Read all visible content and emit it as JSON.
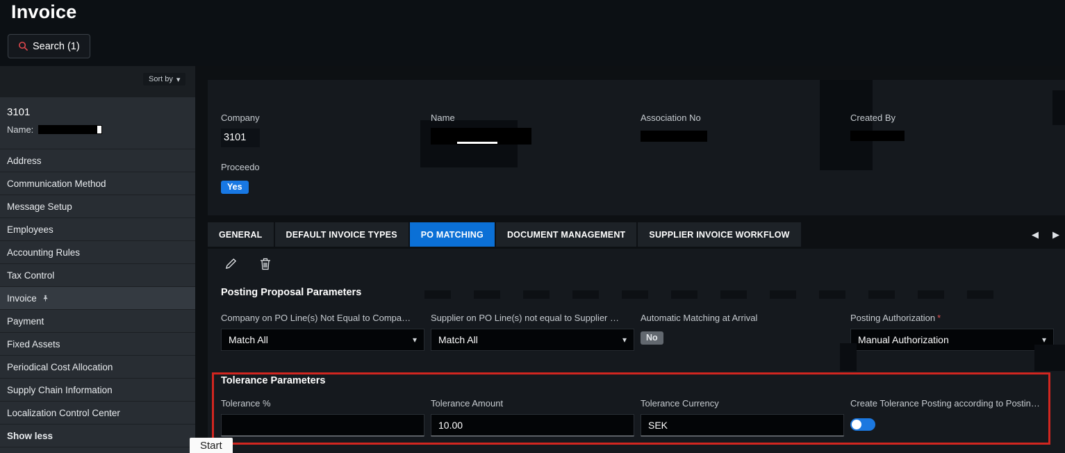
{
  "header": {
    "title": "Invoice",
    "search_button": "Search (1)"
  },
  "sidebar": {
    "sort_by_label": "Sort by",
    "record_id": "3101",
    "record_name_label": "Name:",
    "items": [
      "Address",
      "Communication Method",
      "Message Setup",
      "Employees",
      "Accounting Rules",
      "Tax Control",
      "Invoice",
      "Payment",
      "Fixed Assets",
      "Periodical Cost Allocation",
      "Supply Chain Information",
      "Localization Control Center",
      "Show less"
    ]
  },
  "summary": {
    "company_label": "Company",
    "company_value": "3101",
    "name_label": "Name",
    "association_label": "Association No",
    "created_by_label": "Created By",
    "proceedo_label": "Proceedo",
    "proceedo_value": "Yes"
  },
  "tabs": [
    "GENERAL",
    "DEFAULT INVOICE TYPES",
    "PO MATCHING",
    "DOCUMENT MANAGEMENT",
    "SUPPLIER INVOICE WORKFLOW"
  ],
  "posting": {
    "title": "Posting Proposal Parameters",
    "field1_label": "Company on PO Line(s) Not Equal to Compa…",
    "field1_value": "Match All",
    "field2_label": "Supplier on PO Line(s) not equal to Supplier …",
    "field2_value": "Match All",
    "field3_label": "Automatic Matching at Arrival",
    "field3_value": "No",
    "field4_label": "Posting Authorization",
    "field4_required": "*",
    "field4_value": "Manual Authorization"
  },
  "tolerance": {
    "title": "Tolerance Parameters",
    "field1_label": "Tolerance %",
    "field1_value": "",
    "field2_label": "Tolerance Amount",
    "field2_value": "10.00",
    "field3_label": "Tolerance Currency",
    "field3_value": "SEK",
    "field4_label": "Create Tolerance Posting according to Postin…"
  },
  "taskbar": {
    "start_label": "Start"
  },
  "icons": {
    "chevron_down": "▾",
    "tab_prev": "◀",
    "tab_next": "▶"
  },
  "colors": {
    "accent_blue": "#0b70d6",
    "badge_blue": "#1878e4",
    "badge_gray": "#62686f",
    "annotation_red": "#d12620",
    "search_icon_red": "#e0484d",
    "toggle_on": "#1b78e0"
  }
}
